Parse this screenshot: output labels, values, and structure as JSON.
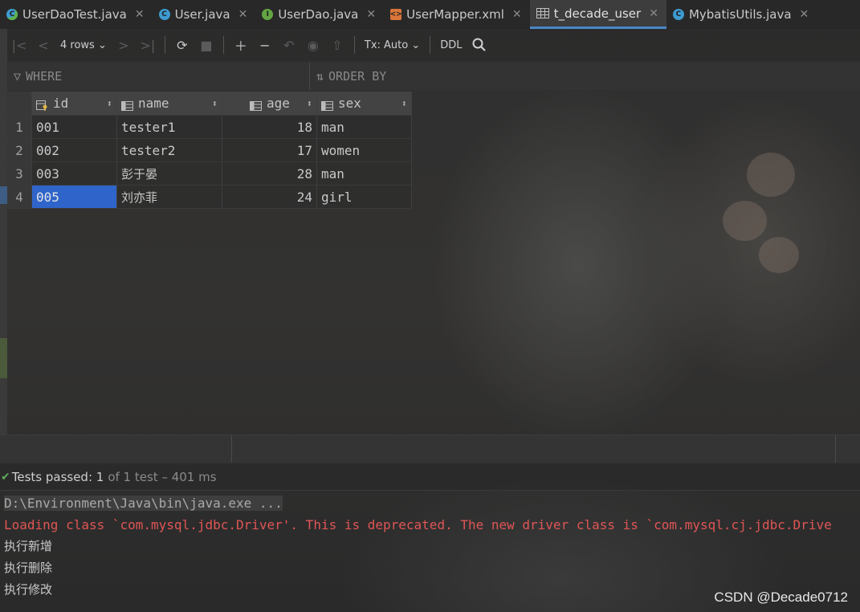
{
  "tabs": [
    {
      "label": "UserDaoTest.java",
      "icon": "test-class-icon",
      "active": false
    },
    {
      "label": "User.java",
      "icon": "class-icon",
      "active": false
    },
    {
      "label": "UserDao.java",
      "icon": "interface-icon",
      "active": false
    },
    {
      "label": "UserMapper.xml",
      "icon": "xml-icon",
      "active": false
    },
    {
      "label": "t_decade_user",
      "icon": "table-icon",
      "active": true
    },
    {
      "label": "MybatisUtils.java",
      "icon": "class-icon",
      "active": false
    }
  ],
  "toolbar": {
    "rows_label": "4 rows",
    "tx_label": "Tx: Auto",
    "ddl_label": "DDL"
  },
  "filter": {
    "where_label": "WHERE",
    "order_by_label": "ORDER BY"
  },
  "grid": {
    "columns": [
      "id",
      "name",
      "age",
      "sex"
    ],
    "rows": [
      {
        "num": "1",
        "id": "001",
        "name": "tester1",
        "age": "18",
        "sex": "man"
      },
      {
        "num": "2",
        "id": "002",
        "name": "tester2",
        "age": "17",
        "sex": "women"
      },
      {
        "num": "3",
        "id": "003",
        "name": "彭于晏",
        "age": "28",
        "sex": "man"
      },
      {
        "num": "4",
        "id": "005",
        "name": "刘亦菲",
        "age": "24",
        "sex": "girl"
      }
    ],
    "selected_cell": "row 4, id"
  },
  "test_status": {
    "main": "Tests passed: 1",
    "sub": "of 1 test – 401 ms"
  },
  "console": {
    "cmd": "D:\\Environment\\Java\\bin\\java.exe ...",
    "warning": "Loading class `com.mysql.jdbc.Driver'. This is deprecated. The new driver class is `com.mysql.cj.jdbc.Drive",
    "outputs": [
      "执行新增",
      "执行删除",
      "执行修改"
    ]
  },
  "watermark": "CSDN @Decade0712",
  "colors": {
    "accent": "#4a88c7",
    "selection": "#2f65ca",
    "error": "#e05555",
    "success": "#5fa85a"
  }
}
